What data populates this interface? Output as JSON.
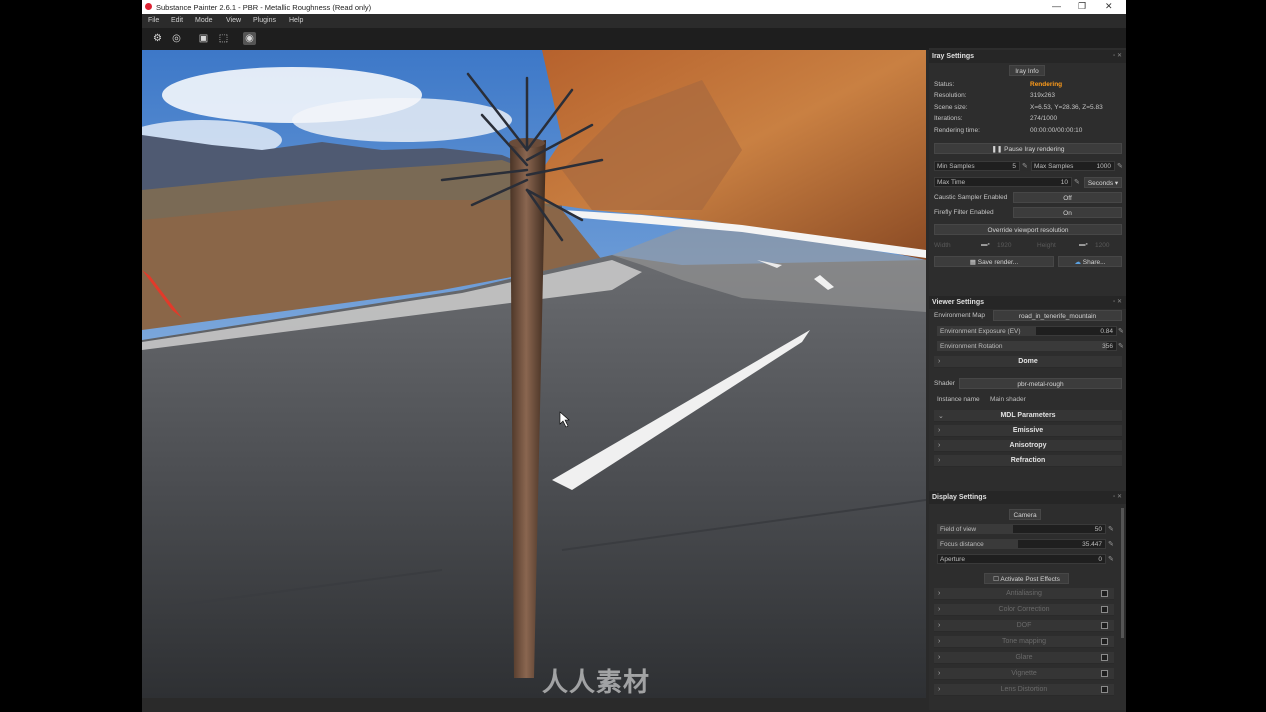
{
  "window": {
    "title": "Substance Painter 2.6.1 - PBR - Metallic Roughness (Read only)",
    "minimize": "—",
    "maximize": "❐",
    "close": "✕"
  },
  "menu": [
    "File",
    "Edit",
    "Mode",
    "View",
    "Plugins",
    "Help"
  ],
  "toolbar": {
    "icons": [
      "camera-settings-icon",
      "environment-icon",
      "render-display-icon",
      "layout-icon",
      "iray-icon"
    ]
  },
  "iray": {
    "header": "Iray Settings",
    "info_tab": "Iray Info",
    "rows": [
      {
        "label": "Status:",
        "value": "Rendering"
      },
      {
        "label": "Resolution:",
        "value": "319x263"
      },
      {
        "label": "Scene size:",
        "value": "X=6.53, Y=28.36, Z=5.83"
      },
      {
        "label": "Iterations:",
        "value": "274/1000"
      },
      {
        "label": "Rendering time:",
        "value": "00:00:00/00:00:10"
      }
    ],
    "status_color": "#ff9c1a",
    "pause_button": "Pause Iray rendering",
    "min_samples_label": "Min Samples",
    "min_samples_value": "5",
    "max_samples_label": "Max Samples",
    "max_samples_value": "1000",
    "max_time_label": "Max Time",
    "max_time_value": "10",
    "max_time_unit": "Seconds",
    "caustic_label": "Caustic Sampler Enabled",
    "caustic_value": "Off",
    "firefly_label": "Firefly Filter Enabled",
    "firefly_value": "On",
    "override_button": "Override viewport resolution",
    "width_label": "Width",
    "width_value": "1920",
    "height_label": "Height",
    "height_value": "1200",
    "save_button": "Save render...",
    "share_button": "Share..."
  },
  "viewer": {
    "header": "Viewer Settings",
    "env_map_label": "Environment Map",
    "env_map_value": "road_in_tenerife_mountain",
    "exposure_label": "Environment Exposure (EV)",
    "exposure_value": "0.84",
    "rotation_label": "Environment Rotation",
    "rotation_value": "356",
    "dome_label": "Dome",
    "shader_label": "Shader",
    "shader_value": "pbr-metal-rough",
    "instance_label": "Instance name",
    "instance_value": "Main shader",
    "groups": [
      "MDL Parameters",
      "Emissive",
      "Anisotropy",
      "Refraction"
    ]
  },
  "display": {
    "header": "Display Settings",
    "camera_tab": "Camera",
    "fov_label": "Field of view",
    "fov_value": "50",
    "focus_label": "Focus distance",
    "focus_value": "35.447",
    "aperture_label": "Aperture",
    "aperture_value": "0",
    "post_effects_label": "Activate Post Effects",
    "effects": [
      "Antialiasing",
      "Color Correction",
      "DOF",
      "Tone mapping",
      "Glare",
      "Vignette",
      "Lens Distortion"
    ]
  },
  "watermark": "人人素材"
}
